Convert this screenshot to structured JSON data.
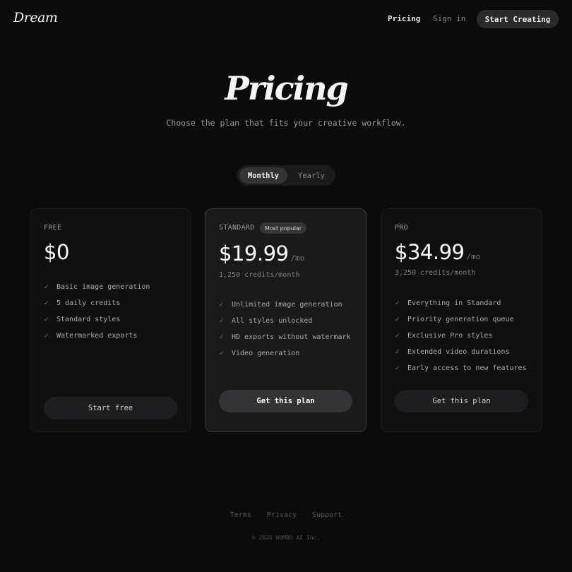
{
  "nav": {
    "logo": "Dream",
    "pricing": "Pricing",
    "sign_in": "Sign in",
    "cta": "Start Creating"
  },
  "hero": {
    "title": "Pricing",
    "subtitle": "Choose the plan that fits your creative workflow."
  },
  "billing_toggle": {
    "monthly": "Monthly",
    "yearly": "Yearly",
    "selected": "Monthly"
  },
  "plans": [
    {
      "name": "FREE",
      "price": "$0",
      "features": [
        "Basic image generation",
        "5 daily credits",
        "Standard styles",
        "Watermarked exports"
      ],
      "button": "Start free"
    },
    {
      "name": "STANDARD",
      "badge": "Most popular",
      "price": "$19.99",
      "period": "/mo",
      "credits": "1,250 credits/month",
      "features": [
        "Unlimited image generation",
        "All styles unlocked",
        "HD exports without watermark",
        "Video generation"
      ],
      "button": "Get this plan"
    },
    {
      "name": "PRO",
      "price": "$34.99",
      "period": "/mo",
      "credits": "3,250 credits/month",
      "features": [
        "Everything in Standard",
        "Priority generation queue",
        "Exclusive Pro styles",
        "Extended video durations",
        "Early access to new features"
      ],
      "button": "Get this plan"
    }
  ],
  "footer": {
    "links": [
      "Terms",
      "Privacy",
      "Support"
    ],
    "copyright": "© 2026 WOMBO AI Inc."
  },
  "icons": {
    "feature_check": "check-icon"
  }
}
